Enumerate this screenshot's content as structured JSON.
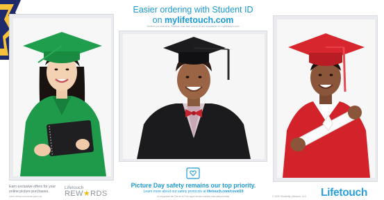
{
  "header": {
    "line1": "Easier ordering with Student ID",
    "line2_prefix": "on ",
    "line2_url": "mylifetouch.com",
    "fineprint": "Ordene pre-imenero. Pedidos más fácil con la ID del estudiante en mylifetouch.com"
  },
  "photos": {
    "left_alt": "Student in green cap and gown holding a notebook",
    "center_alt": "Student in black cap and gown",
    "right_alt": "Student in red cap and gown holding a diploma"
  },
  "safety": {
    "icon": "shield-heart-icon",
    "title": "Picture Day safety remains our top priority.",
    "sub_prefix": "Learn more about our safety protocols at ",
    "sub_url": "lifetouch.com/covid19",
    "fineprint": "La seguridad del Día de la Foto sigue siendo nuestra más alta prioridad."
  },
  "rewards": {
    "earn_text": "Earn exclusive offers for your online picture purchases.",
    "earn_fine": "Gane ofertas exclusivas para sus",
    "brand_top": "Lifetouch",
    "brand_bottom_a": "REW",
    "brand_star": "★",
    "brand_bottom_b": "RDS"
  },
  "footer": {
    "copyright": "© 2020 Shutterfly Lifetouch, LLC",
    "logo": "Lifetouch"
  },
  "colors": {
    "brand_blue": "#1b9ad6",
    "green_gown": "#1e9a4a",
    "red_gown": "#d2232a",
    "black_gown": "#1b1b1d",
    "gold_star": "#f2b705"
  }
}
